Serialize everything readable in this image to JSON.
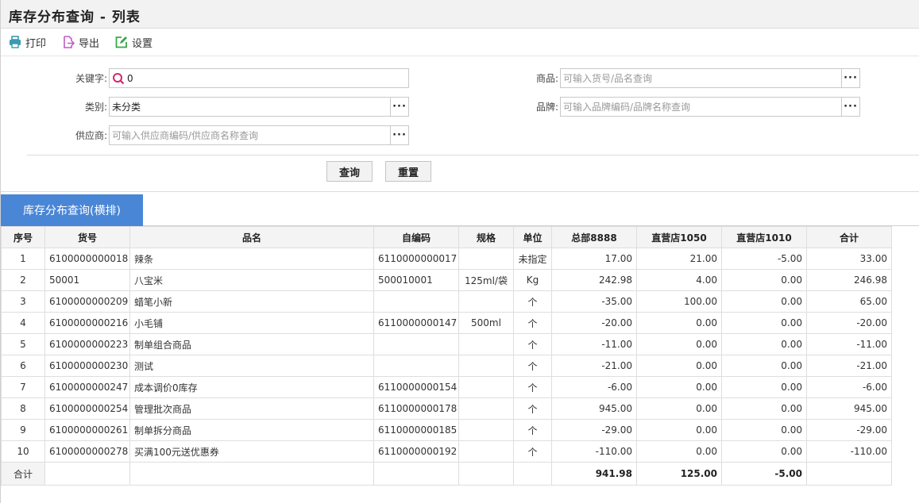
{
  "title": "库存分布查询 - 列表",
  "toolbar": {
    "print": "打印",
    "export": "导出",
    "settings": "设置"
  },
  "filters": {
    "keyword": {
      "label": "关键字:",
      "value": "0"
    },
    "category": {
      "label": "类别:",
      "value": "未分类"
    },
    "supplier": {
      "label": "供应商:",
      "placeholder": "可输入供应商编码/供应商名称查询"
    },
    "product": {
      "label": "商品:",
      "placeholder": "可输入货号/品名查询"
    },
    "brand": {
      "label": "品牌:",
      "placeholder": "可输入品牌编码/品牌名称查询"
    }
  },
  "buttons": {
    "query": "查询",
    "reset": "重置"
  },
  "tab": "库存分布查询(横排)",
  "columns": [
    "序号",
    "货号",
    "品名",
    "自编码",
    "规格",
    "单位",
    "总部8888",
    "直营店1050",
    "直营店1010",
    "合计"
  ],
  "rows": [
    [
      "1",
      "6100000000018",
      "辣条",
      "6110000000017",
      "",
      "未指定",
      "17.00",
      "21.00",
      "-5.00",
      "33.00"
    ],
    [
      "2",
      "50001",
      "八宝米",
      "500010001",
      "125ml/袋",
      "Kg",
      "242.98",
      "4.00",
      "0.00",
      "246.98"
    ],
    [
      "3",
      "6100000000209",
      "蜡笔小新",
      "",
      "",
      "个",
      "-35.00",
      "100.00",
      "0.00",
      "65.00"
    ],
    [
      "4",
      "6100000000216",
      "小毛铺",
      "6110000000147",
      "500ml",
      "个",
      "-20.00",
      "0.00",
      "0.00",
      "-20.00"
    ],
    [
      "5",
      "6100000000223",
      "制单组合商品",
      "",
      "",
      "个",
      "-11.00",
      "0.00",
      "0.00",
      "-11.00"
    ],
    [
      "6",
      "6100000000230",
      "测试",
      "",
      "",
      "个",
      "-21.00",
      "0.00",
      "0.00",
      "-21.00"
    ],
    [
      "7",
      "6100000000247",
      "成本调价0库存",
      "6110000000154",
      "",
      "个",
      "-6.00",
      "0.00",
      "0.00",
      "-6.00"
    ],
    [
      "8",
      "6100000000254",
      "管理批次商品",
      "6110000000178",
      "",
      "个",
      "945.00",
      "0.00",
      "0.00",
      "945.00"
    ],
    [
      "9",
      "6100000000261",
      "制单拆分商品",
      "6110000000185",
      "",
      "个",
      "-29.00",
      "0.00",
      "0.00",
      "-29.00"
    ],
    [
      "10",
      "6100000000278",
      "买满100元送优惠券",
      "6110000000192",
      "",
      "个",
      "-110.00",
      "0.00",
      "0.00",
      "-110.00"
    ]
  ],
  "totals": {
    "label": "合计",
    "hq": "941.98",
    "store1050": "125.00",
    "store1010": "-5.00"
  },
  "colors": {
    "tab_bg": "#4a86d6",
    "print_icon": "#3a9ab0",
    "export_icon": "#c45ac9",
    "settings_icon": "#3aa64a",
    "search_icon": "#d6256e"
  }
}
